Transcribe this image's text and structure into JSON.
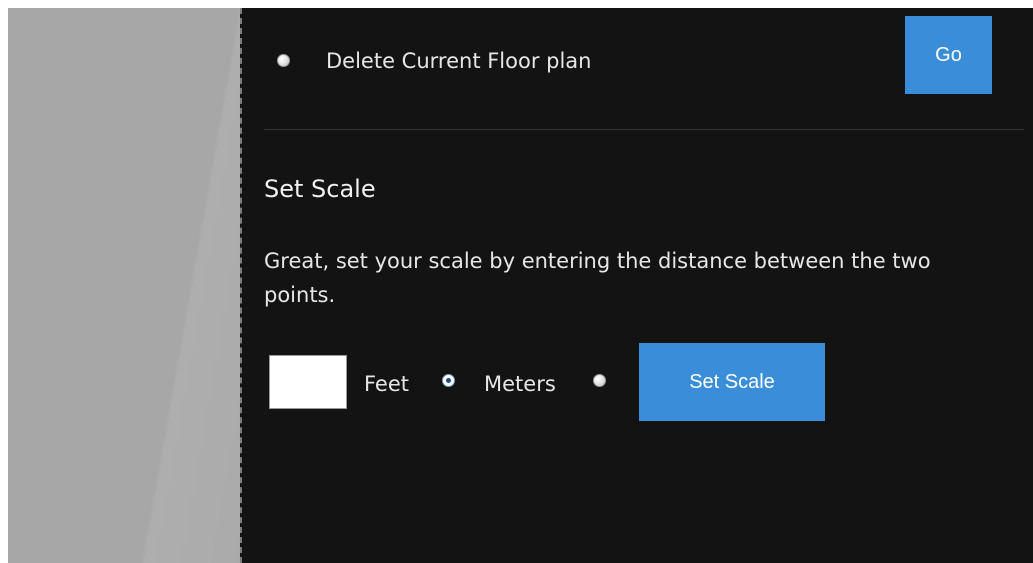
{
  "delete_section": {
    "radio_label": "Delete Current Floor plan",
    "go_button_label": "Go"
  },
  "set_scale": {
    "heading": "Set Scale",
    "instructions": "Great, set your scale by entering the distance between the two points.",
    "distance_value": "",
    "unit_feet_label": "Feet",
    "unit_meters_label": "Meters",
    "selected_unit": "Feet",
    "submit_label": "Set Scale"
  },
  "colors": {
    "panel_background": "#131313",
    "canvas_background": "#a7a7a7",
    "button_accent": "#3a8ed9",
    "text": "#e6e6e6"
  }
}
